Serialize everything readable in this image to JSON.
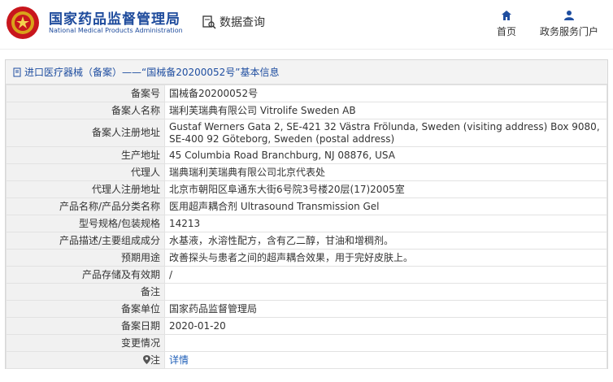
{
  "header": {
    "site_name": "国家药品监督管理局",
    "site_name_en": "National Medical Products Administration",
    "page_title": "数据查询",
    "nav": [
      {
        "label": "首页",
        "icon": "home-icon"
      },
      {
        "label": "政务服务门户",
        "icon": "user-icon"
      }
    ]
  },
  "panel": {
    "title": "进口医疗器械（备案）——“国械备20200052号”基本信息"
  },
  "records": [
    {
      "label": "备案号",
      "value": "国械备20200052号"
    },
    {
      "label": "备案人名称",
      "value": "瑞利芙瑞典有限公司 Vitrolife Sweden AB"
    },
    {
      "label": "备案人注册地址",
      "value": "Gustaf Werners Gata 2, SE-421 32 Västra Frölunda, Sweden (visiting address) Box 9080, SE-400 92 Göteborg, Sweden (postal address)"
    },
    {
      "label": "生产地址",
      "value": "45 Columbia Road Branchburg, NJ 08876, USA"
    },
    {
      "label": "代理人",
      "value": "瑞典瑞利芙瑞典有限公司北京代表处"
    },
    {
      "label": "代理人注册地址",
      "value": "北京市朝阳区阜通东大街6号院3号楼20层(17)2005室"
    },
    {
      "label": "产品名称/产品分类名称",
      "value": "医用超声耦合剂 Ultrasound Transmission Gel"
    },
    {
      "label": "型号规格/包装规格",
      "value": "14213"
    },
    {
      "label": "产品描述/主要组成成分",
      "value": "水基液，水溶性配方，含有乙二醇，甘油和增稠剂。"
    },
    {
      "label": "预期用途",
      "value": "改善探头与患者之间的超声耦合效果，用于完好皮肤上。"
    },
    {
      "label": "产品存储及有效期",
      "value": "/"
    },
    {
      "label": "备注",
      "value": ""
    },
    {
      "label": "备案单位",
      "value": "国家药品监督管理局"
    },
    {
      "label": "备案日期",
      "value": "2020-01-20"
    },
    {
      "label": "变更情况",
      "value": ""
    },
    {
      "label": "注",
      "value": "详情"
    }
  ]
}
